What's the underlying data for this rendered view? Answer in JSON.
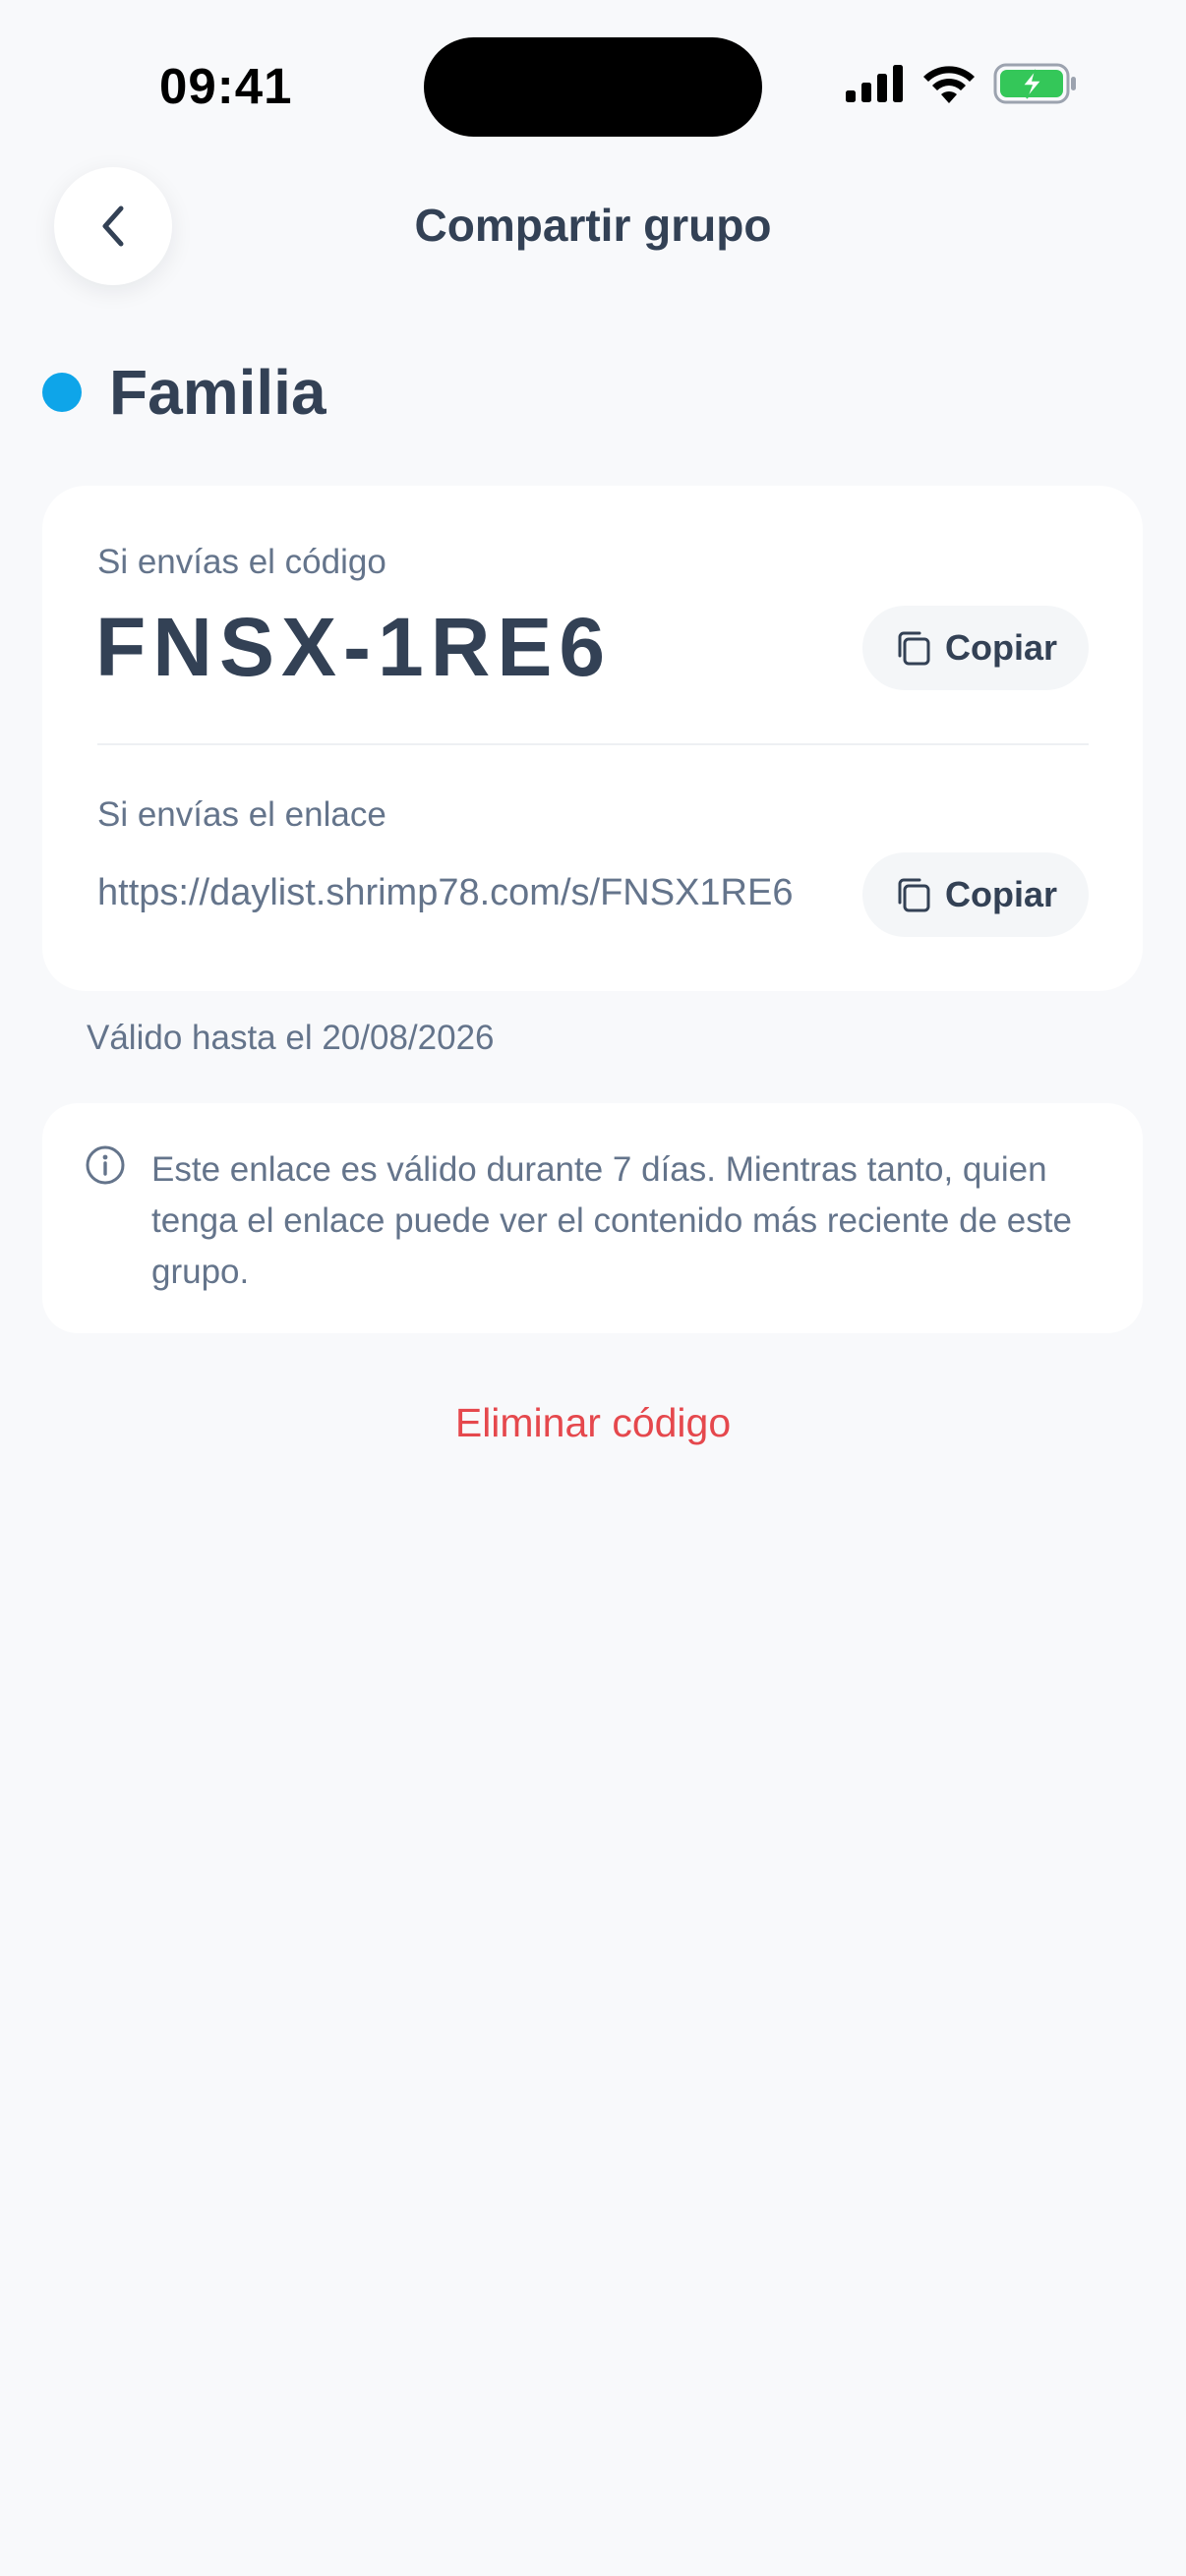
{
  "status_bar": {
    "time": "09:41"
  },
  "header": {
    "title": "Compartir grupo",
    "back_icon": "chevron-left-icon"
  },
  "group": {
    "name": "Familia",
    "color": "#0ea5e9"
  },
  "share": {
    "code_label": "Si envías el código",
    "code": "FNSX-1RE6",
    "link_label": "Si envías el enlace",
    "link": "https://daylist.shrimp78.com/s/FNSX1RE6",
    "copy_label": "Copiar",
    "copy_icon": "copy-icon"
  },
  "valid_until": "Válido hasta el 20/08/2026",
  "info": {
    "icon": "info-icon",
    "text": "Este enlace es válido durante 7 días. Mientras tanto, quien tenga el enlace puede ver el contenido más reciente de este grupo."
  },
  "delete_label": "Eliminar código",
  "colors": {
    "accent_danger": "#e5484d",
    "battery_green": "#34c759"
  }
}
